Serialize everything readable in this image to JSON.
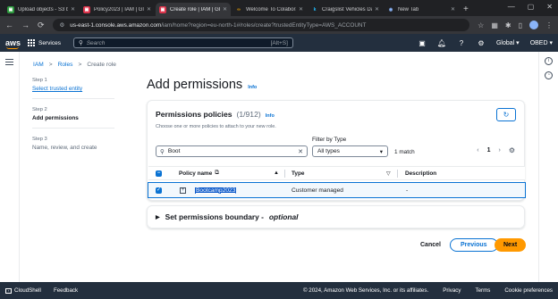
{
  "browser": {
    "tabs": [
      {
        "title": "Upload objects - S3 b",
        "favicon_color": "#2e9b3f",
        "favicon_char": "S3",
        "active": false
      },
      {
        "title": "Policy2023 | IAM | Glo",
        "favicon_color": "#dd344c",
        "favicon_char": "I",
        "active": false
      },
      {
        "title": "Create role | IAM | Glo",
        "favicon_color": "#dd344c",
        "favicon_char": "I",
        "active": true
      },
      {
        "title": "Welcome To Colabora",
        "favicon_color": "#f9ab00",
        "favicon_char": "∞",
        "active": false
      },
      {
        "title": "Craigslist Vehicles Da",
        "favicon_color": "#20beff",
        "favicon_char": "k",
        "active": false
      },
      {
        "title": "New Tab",
        "favicon_color": "#8ab4f8",
        "favicon_char": "",
        "active": false
      }
    ],
    "new_tab_glyph": "+",
    "url_host": "us-east-1.console.aws.amazon.com",
    "url_path": "/iam/home?region=eu-north-1#/roles/create?trustedEntityType=AWS_ACCOUNT"
  },
  "aws_header": {
    "logo": "aws",
    "services_label": "Services",
    "search_placeholder": "Search",
    "search_shortcut": "[Alt+S]",
    "region_label": "Global",
    "account_label": "OBED"
  },
  "breadcrumb": {
    "items": [
      "IAM",
      "Roles",
      "Create role"
    ],
    "sep": ">"
  },
  "steps": [
    {
      "num": "Step 1",
      "label": "Select trusted entity"
    },
    {
      "num": "Step 2",
      "label": "Add permissions"
    },
    {
      "num": "Step 3",
      "label": "Name, review, and create"
    }
  ],
  "page": {
    "title": "Add permissions",
    "info": "Info"
  },
  "policies": {
    "title": "Permissions policies",
    "count": "(1/912)",
    "info": "Info",
    "subtitle": "Choose one or more policies to attach to your new role.",
    "search_value": "Boot",
    "filter_label": "Filter by Type",
    "filter_value": "All types",
    "match_text": "1 match",
    "page_number": "1",
    "columns": {
      "name": "Policy name",
      "type": "Type",
      "description": "Description"
    },
    "rows": [
      {
        "name": "Bootcamp2023",
        "type": "Customer managed",
        "description": "-"
      }
    ]
  },
  "boundary": {
    "title": "Set permissions boundary -",
    "optional": "optional"
  },
  "actions": {
    "cancel": "Cancel",
    "previous": "Previous",
    "next": "Next"
  },
  "footer": {
    "cloudshell": "CloudShell",
    "feedback": "Feedback",
    "copyright": "© 2024, Amazon Web Services, Inc. or its affiliates.",
    "privacy": "Privacy",
    "terms": "Terms",
    "cookies": "Cookie preferences"
  }
}
